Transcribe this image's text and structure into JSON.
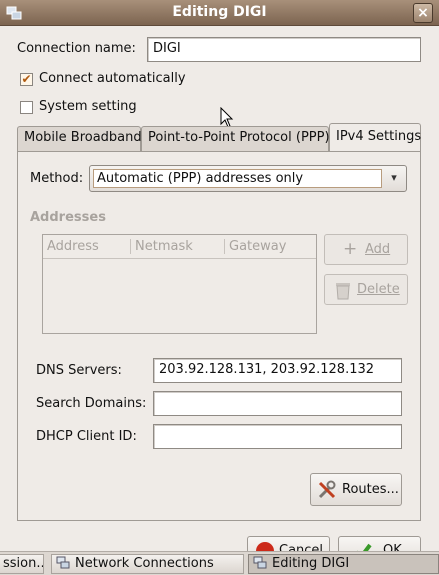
{
  "window": {
    "title": "Editing DIGI",
    "close_glyph": "×"
  },
  "connection_name": {
    "label": "Connection name:",
    "value": "DIGI"
  },
  "connect_automatically": {
    "label": "Connect automatically",
    "checked": true
  },
  "system_setting": {
    "label": "System setting",
    "checked": false
  },
  "tabs": [
    {
      "label": "Mobile Broadband",
      "active": false
    },
    {
      "label": "Point-to-Point Protocol (PPP)",
      "active": false
    },
    {
      "label": "IPv4 Settings",
      "active": true
    }
  ],
  "method": {
    "label": "Method:",
    "value": "Automatic (PPP) addresses only"
  },
  "addresses": {
    "heading": "Addresses",
    "columns": [
      "Address",
      "Netmask",
      "Gateway"
    ],
    "add_label": "Add",
    "delete_label": "Delete"
  },
  "dns_servers": {
    "label": "DNS Servers:",
    "value": "203.92.128.131, 203.92.128.132"
  },
  "search_domains": {
    "label": "Search Domains:",
    "value": ""
  },
  "dhcp_client_id": {
    "label": "DHCP Client ID:",
    "value": ""
  },
  "routes_label": "Routes...",
  "dialog_buttons": {
    "cancel_label": "Cancel",
    "ok_label": "OK"
  },
  "taskbar": {
    "items": [
      {
        "label": "ssion...",
        "active": false
      },
      {
        "label": "Network Connections",
        "active": false
      },
      {
        "label": "Editing DIGI",
        "active": true
      }
    ]
  },
  "colors": {
    "titlebar": "#8c735e",
    "accent": "#b05a10",
    "disabled_text": "#a8a39e"
  }
}
